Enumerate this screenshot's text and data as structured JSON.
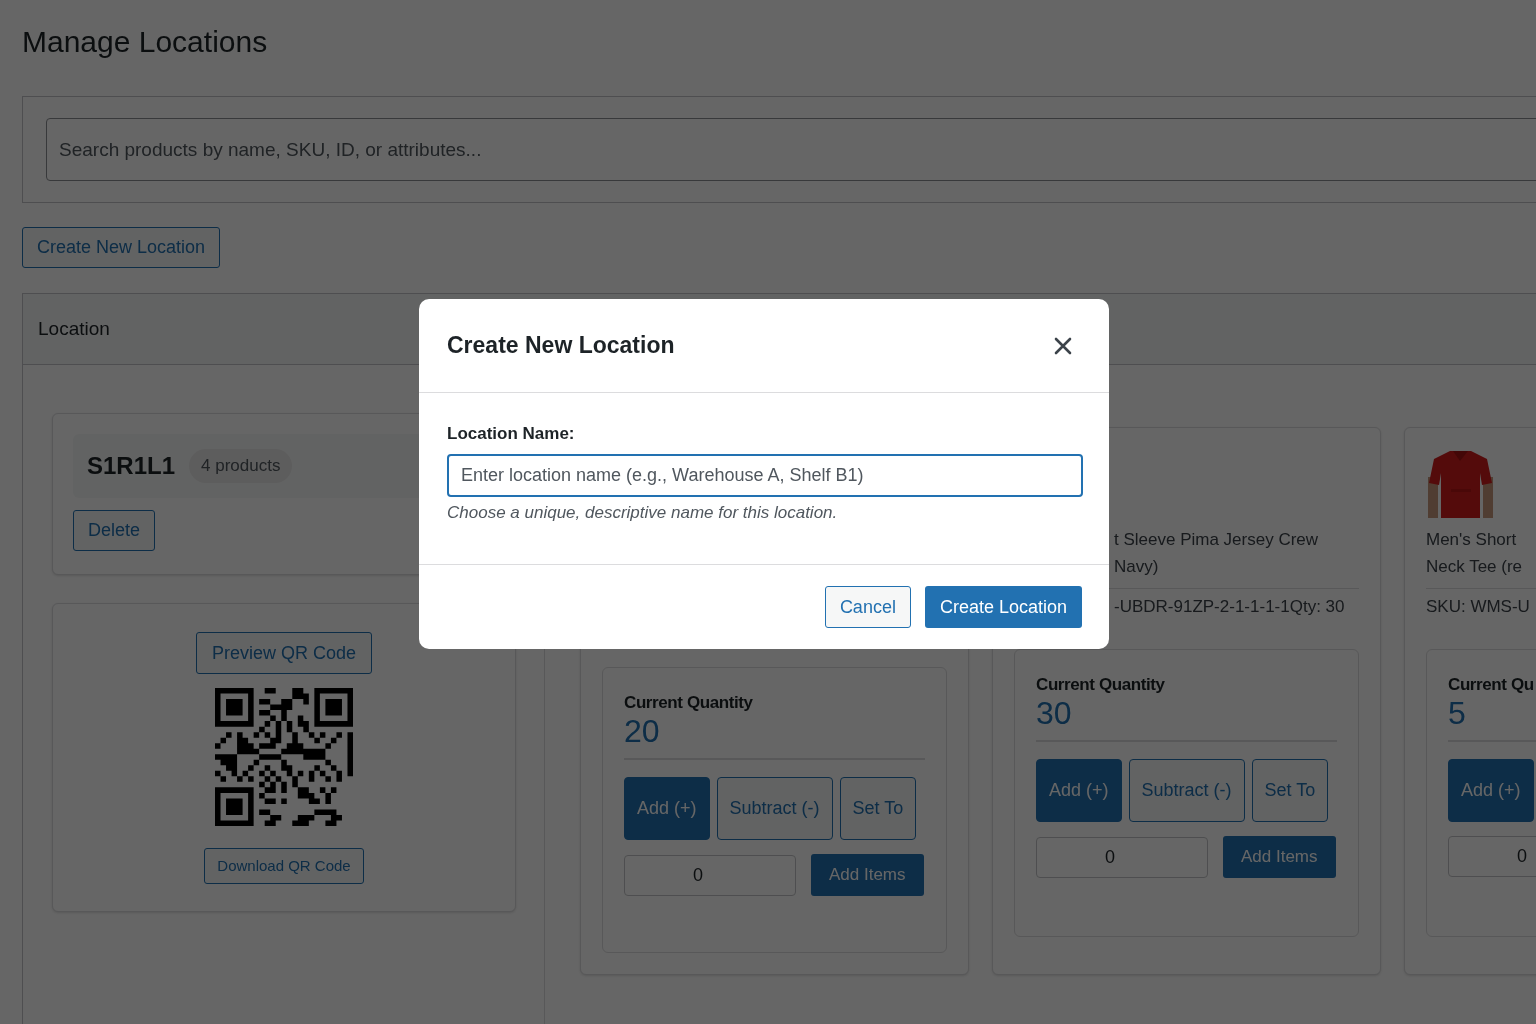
{
  "page_title": "Manage Locations",
  "search": {
    "placeholder": "Search products by name, SKU, ID, or attributes..."
  },
  "create_button": "Create New Location",
  "panel": {
    "header": "Location"
  },
  "location": {
    "name": "S1R1L1",
    "count": "4 products",
    "delete": "Delete",
    "preview_qr": "Preview QR Code",
    "download_qr": "Download QR Code"
  },
  "products": [
    {
      "quantity_label": "Current Quantity",
      "quantity": "20",
      "actions": [
        {
          "label": "Add (+)",
          "selected": true
        },
        {
          "label": "Subtract (-)",
          "selected": false
        },
        {
          "label": "Set To",
          "selected": false
        }
      ],
      "value": "0",
      "submit": "Add Items"
    },
    {
      "name_lines": [
        "t Sleeve Pima Jersey Crew",
        "Navy)"
      ],
      "sku": "-UBDR-91ZP-2-1-1-1-1Qty: 30",
      "quantity_label": "Current Quantity",
      "quantity": "30",
      "actions": [
        {
          "label": "Add (+)",
          "selected": true
        },
        {
          "label": "Subtract (-)",
          "selected": false
        },
        {
          "label": "Set To",
          "selected": false
        }
      ],
      "value": "0",
      "submit": "Add Items"
    },
    {
      "image": {
        "kind": "picture"
      },
      "name_lines": [
        "Men's Short",
        "Neck Tee (re"
      ],
      "sku": "SKU: WMS-U",
      "quantity_label": "Current Qu",
      "quantity": "5",
      "actions": [
        {
          "label": "Add (+)",
          "selected": true
        }
      ],
      "value": "0"
    }
  ],
  "modal": {
    "title": "Create New Location",
    "field_label": "Location Name:",
    "placeholder": "Enter location name (e.g., Warehouse A, Shelf B1)",
    "help": "Choose a unique, descriptive name for this location.",
    "cancel": "Cancel",
    "confirm": "Create Location"
  }
}
